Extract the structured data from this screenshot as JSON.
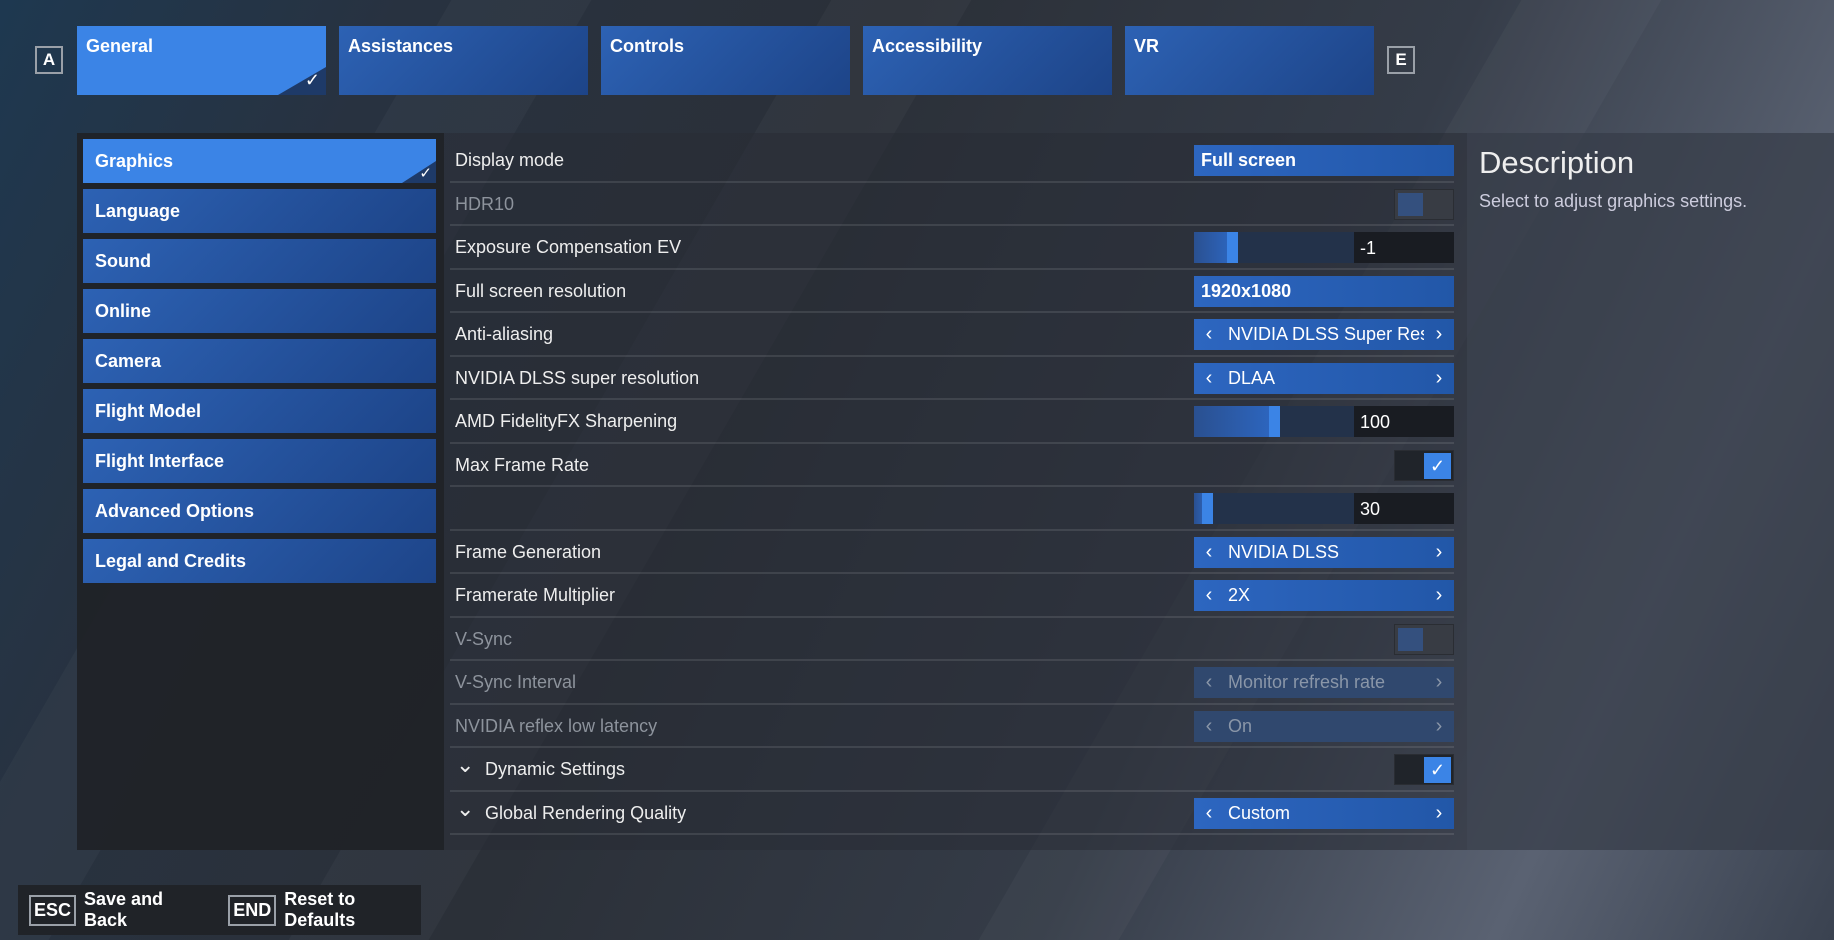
{
  "keys": {
    "prev_tab": "A",
    "next_tab": "E"
  },
  "tabs": [
    {
      "label": "General",
      "active": true
    },
    {
      "label": "Assistances"
    },
    {
      "label": "Controls"
    },
    {
      "label": "Accessibility"
    },
    {
      "label": "VR"
    }
  ],
  "sidebar": {
    "items": [
      {
        "label": "Graphics",
        "active": true
      },
      {
        "label": "Language"
      },
      {
        "label": "Sound"
      },
      {
        "label": "Online"
      },
      {
        "label": "Camera"
      },
      {
        "label": "Flight Model"
      },
      {
        "label": "Flight Interface"
      },
      {
        "label": "Advanced Options"
      },
      {
        "label": "Legal and Credits"
      }
    ]
  },
  "settings": [
    {
      "label": "Display mode",
      "type": "select",
      "value": "Full screen"
    },
    {
      "label": "HDR10",
      "type": "toggle",
      "on": false,
      "disabled": true
    },
    {
      "label": "Exposure Compensation EV",
      "type": "slider",
      "value": "-1",
      "level": 0.24
    },
    {
      "label": "Full screen resolution",
      "type": "select",
      "value": "1920x1080"
    },
    {
      "label": "Anti-aliasing",
      "type": "spin",
      "value": "NVIDIA DLSS Super Resolution"
    },
    {
      "label": "NVIDIA DLSS super resolution",
      "type": "spin",
      "value": "DLAA"
    },
    {
      "label": "AMD FidelityFX Sharpening",
      "type": "slider",
      "value": "100",
      "level": 0.5
    },
    {
      "label": "Max Frame Rate",
      "type": "toggle",
      "on": true
    },
    {
      "label": "",
      "type": "slider",
      "value": "30",
      "level": 0.08
    },
    {
      "label": "Frame Generation",
      "type": "spin",
      "value": "NVIDIA DLSS"
    },
    {
      "label": "Framerate Multiplier",
      "type": "spin",
      "value": "2X"
    },
    {
      "label": "V-Sync",
      "type": "toggle",
      "on": false,
      "disabled": true
    },
    {
      "label": "V-Sync Interval",
      "type": "spin",
      "value": "Monitor refresh rate",
      "disabled": true
    },
    {
      "label": "NVIDIA reflex low latency",
      "type": "spin",
      "value": "On",
      "disabled": true
    },
    {
      "label": "Dynamic Settings",
      "type": "toggle",
      "on": true,
      "expandable": true
    },
    {
      "label": "Global Rendering Quality",
      "type": "spin",
      "value": "Custom",
      "expandable": true
    }
  ],
  "description": {
    "title": "Description",
    "text": "Select to adjust graphics settings."
  },
  "footer": [
    {
      "key": "ESC",
      "label": "Save and Back"
    },
    {
      "key": "END",
      "label": "Reset to Defaults"
    }
  ],
  "colors": {
    "accent": "#3b84e6",
    "tab": "#2257a8"
  }
}
